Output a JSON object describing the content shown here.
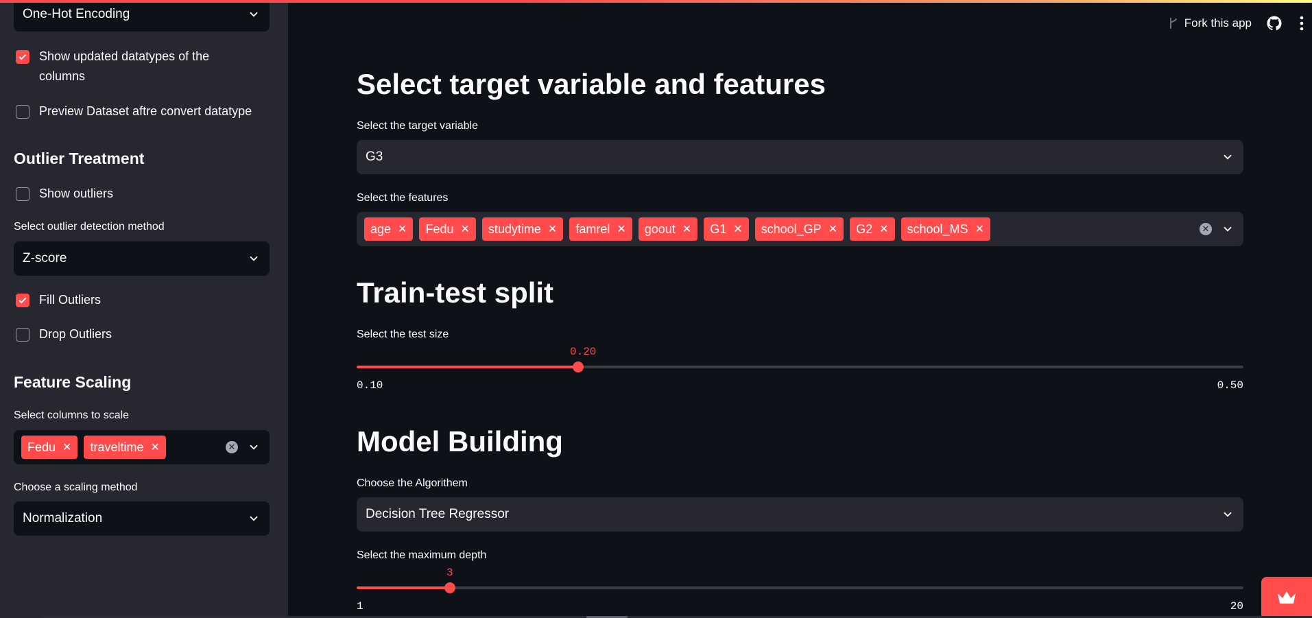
{
  "sidebar": {
    "encoding_select": {
      "value": "One-Hot Encoding"
    },
    "show_updated_datatypes": {
      "label": "Show updated datatypes of the columns",
      "checked": true
    },
    "preview_dataset": {
      "label": "Preview Dataset aftre convert datatype",
      "checked": false
    },
    "outlier": {
      "heading": "Outlier Treatment",
      "show_outliers": {
        "label": "Show outliers",
        "checked": false
      },
      "method_label": "Select outlier detection method",
      "method_value": "Z-score",
      "fill_outliers": {
        "label": "Fill Outliers",
        "checked": true
      },
      "drop_outliers": {
        "label": "Drop Outliers",
        "checked": false
      }
    },
    "scaling": {
      "heading": "Feature Scaling",
      "columns_label": "Select columns to scale",
      "columns": [
        "Fedu",
        "traveltime"
      ],
      "method_label": "Choose a scaling method",
      "method_value": "Normalization"
    }
  },
  "header": {
    "fork_label": "Fork this app"
  },
  "main": {
    "target_section": {
      "title": "Select target variable and features",
      "target_label": "Select the target variable",
      "target_value": "G3",
      "features_label": "Select the features",
      "features": [
        "age",
        "Fedu",
        "studytime",
        "famrel",
        "goout",
        "G1",
        "school_GP",
        "G2",
        "school_MS"
      ]
    },
    "split_section": {
      "title": "Train-test split",
      "test_size_label": "Select the test size",
      "test_size": {
        "value": "0.20",
        "min": "0.10",
        "max": "0.50",
        "fraction": 0.25
      }
    },
    "model_section": {
      "title": "Model Building",
      "algorithm_label": "Choose the Algorithem",
      "algorithm_value": "Decision Tree Regressor",
      "max_depth_label": "Select the maximum depth",
      "max_depth": {
        "value": "3",
        "min": "1",
        "max": "20",
        "fraction": 0.105
      }
    }
  },
  "icons": [
    "chevron-down-icon",
    "close-icon",
    "clear-icon",
    "fork-icon",
    "github-icon",
    "kebab-menu-icon",
    "crown-icon"
  ],
  "colors": {
    "accent": "#ff4b4b",
    "background": "#0e1117",
    "sidebar": "#262730",
    "input": "#262730"
  }
}
